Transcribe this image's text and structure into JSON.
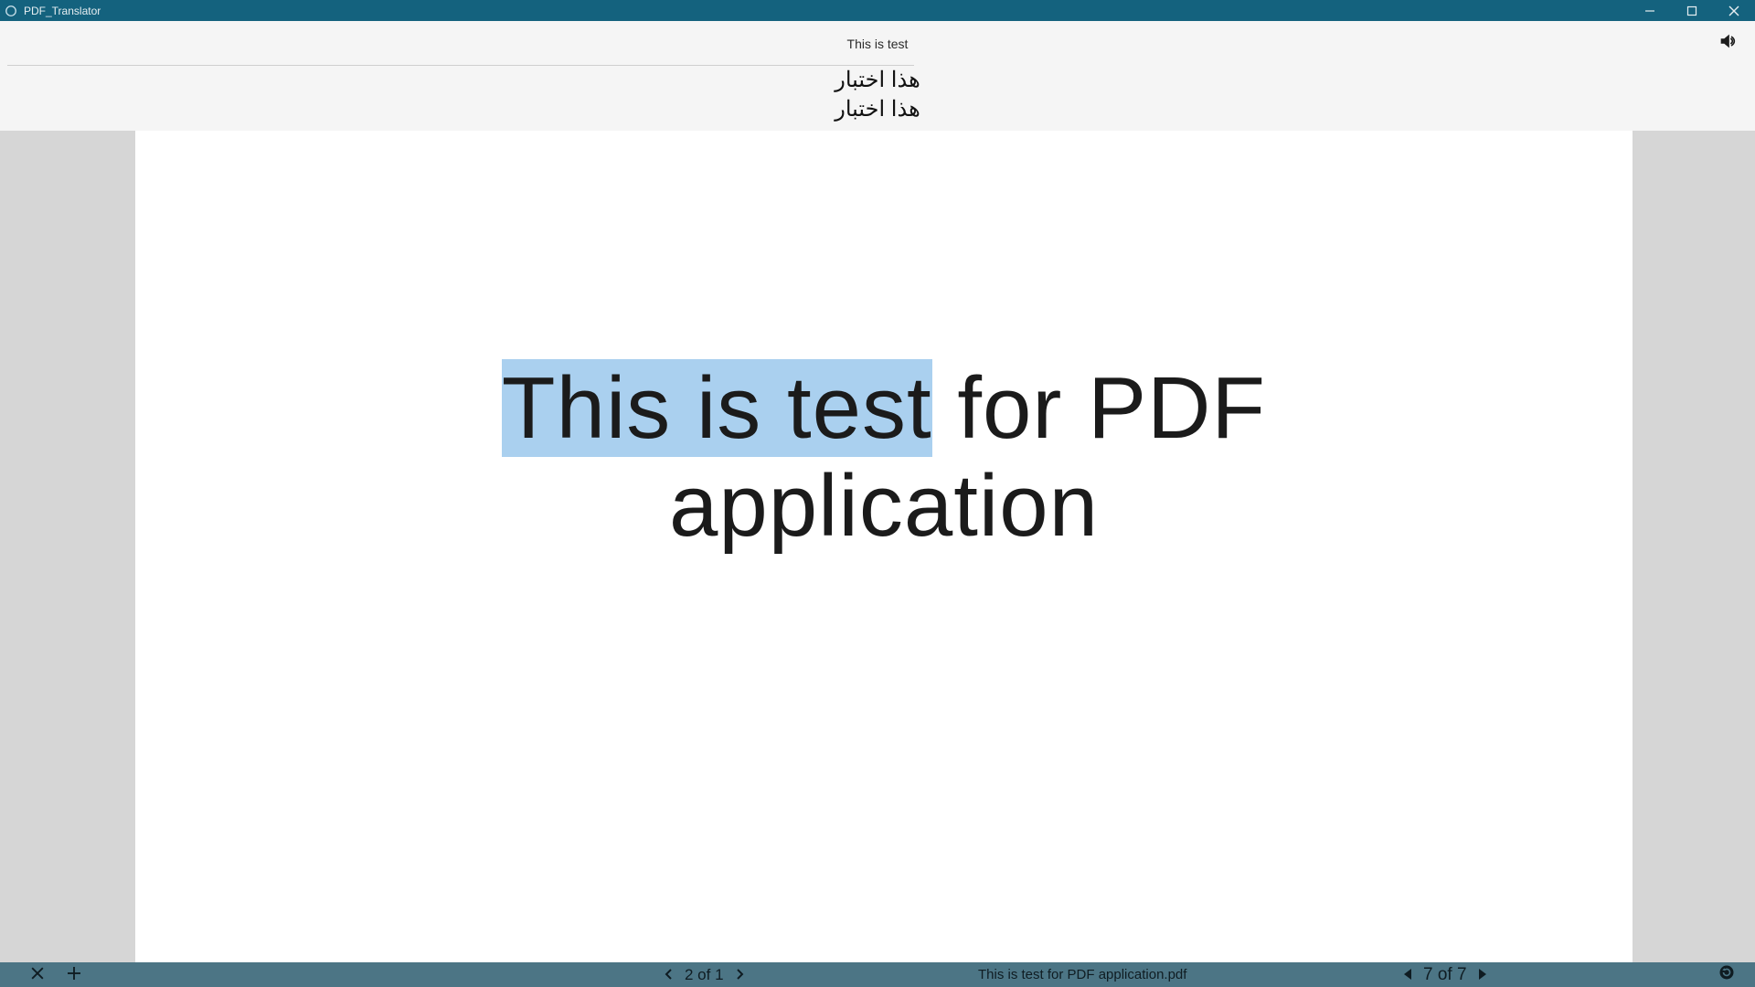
{
  "window": {
    "title": "PDF_Translator"
  },
  "translation": {
    "source": "This is test",
    "target_lines": [
      "هذا اختبار",
      "هذا اختبار"
    ]
  },
  "document": {
    "highlighted": "This is test",
    "rest_line1": " for PDF",
    "line2": "application"
  },
  "statusbar": {
    "left_counter": "2 of 1",
    "filename": "This is test for PDF application.pdf",
    "right_counter": "7 of 7"
  }
}
